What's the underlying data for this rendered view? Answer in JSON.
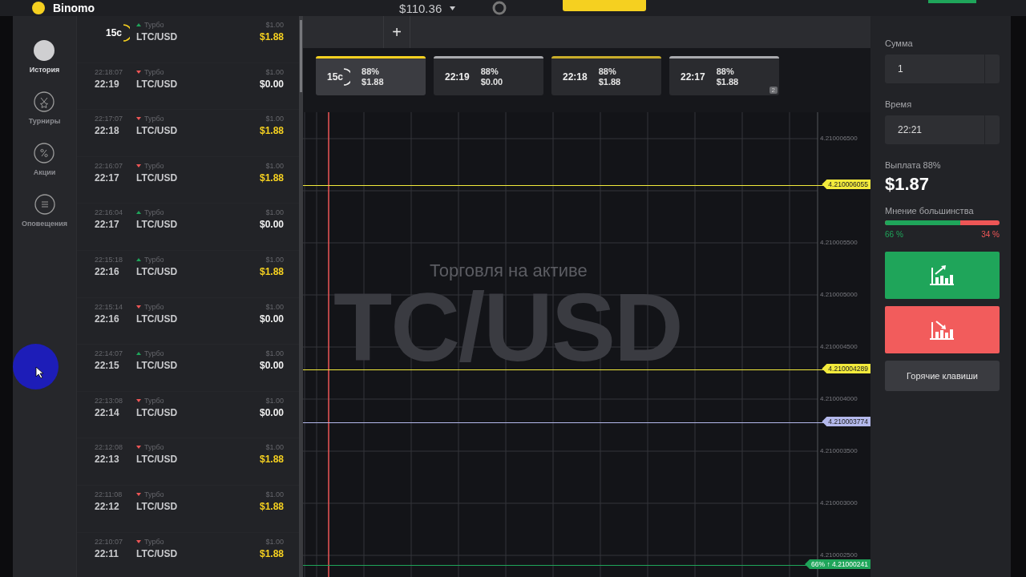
{
  "top_bar": {
    "logo": "Binomo",
    "balance": "$110.36"
  },
  "nav": [
    {
      "label": "История",
      "kind": "avatar",
      "selected": true
    },
    {
      "label": "Турниры",
      "kind": "medal",
      "selected": false
    },
    {
      "label": "Акции",
      "kind": "percent",
      "selected": false
    },
    {
      "label": "Оповещения",
      "kind": "list",
      "selected": false
    }
  ],
  "history": [
    {
      "timer": "15с",
      "up": true,
      "type": "Турбо",
      "pair": "LTC/USD",
      "stake": "$1.00",
      "payout": "$1.88",
      "won": true
    },
    {
      "opened": "22:18:07",
      "closed": "22:19",
      "up": false,
      "type": "Турбо",
      "pair": "LTC/USD",
      "stake": "$1.00",
      "payout": "$0.00",
      "won": false
    },
    {
      "opened": "22:17:07",
      "closed": "22:18",
      "up": false,
      "type": "Турбо",
      "pair": "LTC/USD",
      "stake": "$1.00",
      "payout": "$1.88",
      "won": true
    },
    {
      "opened": "22:16:07",
      "closed": "22:17",
      "up": false,
      "type": "Турбо",
      "pair": "LTC/USD",
      "stake": "$1.00",
      "payout": "$1.88",
      "won": true
    },
    {
      "opened": "22:16:04",
      "closed": "22:17",
      "up": true,
      "type": "Турбо",
      "pair": "LTC/USD",
      "stake": "$1.00",
      "payout": "$0.00",
      "won": false
    },
    {
      "opened": "22:15:18",
      "closed": "22:16",
      "up": true,
      "type": "Турбо",
      "pair": "LTC/USD",
      "stake": "$1.00",
      "payout": "$1.88",
      "won": true
    },
    {
      "opened": "22:15:14",
      "closed": "22:16",
      "up": false,
      "type": "Турбо",
      "pair": "LTC/USD",
      "stake": "$1.00",
      "payout": "$0.00",
      "won": false
    },
    {
      "opened": "22:14:07",
      "closed": "22:15",
      "up": true,
      "type": "Турбо",
      "pair": "LTC/USD",
      "stake": "$1.00",
      "payout": "$0.00",
      "won": false
    },
    {
      "opened": "22:13:08",
      "closed": "22:14",
      "up": false,
      "type": "Турбо",
      "pair": "LTC/USD",
      "stake": "$1.00",
      "payout": "$0.00",
      "won": false
    },
    {
      "opened": "22:12:08",
      "closed": "22:13",
      "up": false,
      "type": "Турбо",
      "pair": "LTC/USD",
      "stake": "$1.00",
      "payout": "$1.88",
      "won": true
    },
    {
      "opened": "22:11:08",
      "closed": "22:12",
      "up": false,
      "type": "Турбо",
      "pair": "LTC/USD",
      "stake": "$1.00",
      "payout": "$1.88",
      "won": true
    },
    {
      "opened": "22:10:07",
      "closed": "22:11",
      "up": false,
      "type": "Турбо",
      "pair": "LTC/USD",
      "stake": "$1.00",
      "payout": "$1.88",
      "won": true
    }
  ],
  "chart_tabs": {
    "add": "+"
  },
  "trade_cards": [
    {
      "timer": "15с",
      "percent": "88%",
      "amount": "$1.88",
      "selected": true,
      "color": "#f5d020"
    },
    {
      "time": "22:19",
      "percent": "88%",
      "amount": "$0.00",
      "selected": false,
      "color": "#a9aaae"
    },
    {
      "time": "22:18",
      "percent": "88%",
      "amount": "$1.88",
      "selected": false,
      "color": "#c9ad2a"
    },
    {
      "time": "22:17",
      "percent": "88%",
      "amount": "$1.88",
      "selected": false,
      "color": "#a9aaae",
      "badge": "2"
    }
  ],
  "chart": {
    "caption": "Торговля на активе",
    "asset": "TC/USD",
    "y_ticks": [
      "4.210006500",
      "4.210005500",
      "4.210005000",
      "4.210004500",
      "4.210004000",
      "4.210003500",
      "4.210003000",
      "4.210002500"
    ],
    "price_lines": [
      {
        "label": "4.210006055",
        "color": "#f2ea3c"
      },
      {
        "label": "4.210004289",
        "color": "#f2ea3c"
      },
      {
        "label": "4.210003774",
        "color": "#b4b9ec"
      },
      {
        "label": "4.21000241",
        "prefix": "66% ↑",
        "color": "#1fa55a"
      }
    ]
  },
  "trade_panel": {
    "amount_label": "Сумма",
    "amount": "1",
    "time_label": "Время",
    "time": "22:21",
    "payout_label": "Выплата 88%",
    "payout": "$1.87",
    "sentiment_label": "Мнение большинства",
    "sentiment": {
      "level": 0.66
    },
    "up_share": "66 %",
    "down_share": "34 %",
    "hotkeys": "Горячие клавиши"
  }
}
